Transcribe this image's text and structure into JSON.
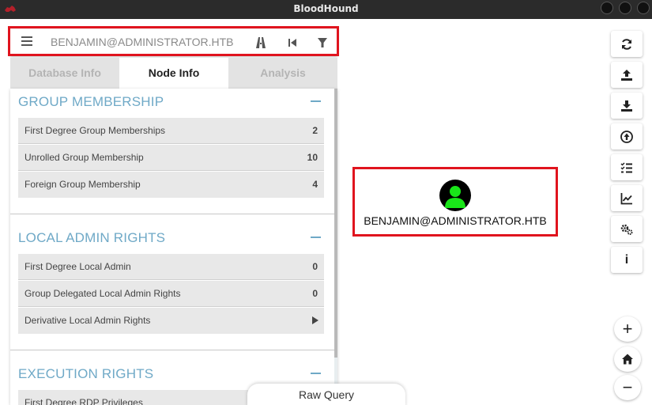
{
  "window": {
    "title": "BloodHound"
  },
  "search": {
    "value": "BENJAMIN@ADMINISTRATOR.HTB"
  },
  "tabs": [
    {
      "label": "Database Info",
      "active": false
    },
    {
      "label": "Node Info",
      "active": true
    },
    {
      "label": "Analysis",
      "active": false
    }
  ],
  "sections": {
    "group_membership": {
      "title": "GROUP MEMBERSHIP",
      "rows": [
        {
          "label": "First Degree Group Memberships",
          "value": "2"
        },
        {
          "label": "Unrolled Group Membership",
          "value": "10"
        },
        {
          "label": "Foreign Group Membership",
          "value": "4"
        }
      ]
    },
    "local_admin": {
      "title": "LOCAL ADMIN RIGHTS",
      "rows": [
        {
          "label": "First Degree Local Admin",
          "value": "0"
        },
        {
          "label": "Group Delegated Local Admin Rights",
          "value": "0"
        },
        {
          "label": "Derivative Local Admin Rights",
          "value": ""
        }
      ]
    },
    "execution": {
      "title": "EXECUTION RIGHTS",
      "rows": [
        {
          "label": "First Degree RDP Privileges",
          "value": ""
        }
      ]
    }
  },
  "graph": {
    "node_label": "BENJAMIN@ADMINISTRATOR.HTB",
    "node_color": "#19e619"
  },
  "toolbar": {
    "buttons": [
      "refresh-icon",
      "upload-icon",
      "download-icon",
      "import-icon",
      "checklist-icon",
      "chart-icon",
      "settings-icon",
      "info-icon"
    ],
    "info_label": "i",
    "zoom_in": "+",
    "zoom_out": "−"
  },
  "raw_query": {
    "label": "Raw Query"
  },
  "colors": {
    "highlight": "#e0141e",
    "section_title": "#6fa9c7",
    "titlebar": "#2b2b2b"
  }
}
